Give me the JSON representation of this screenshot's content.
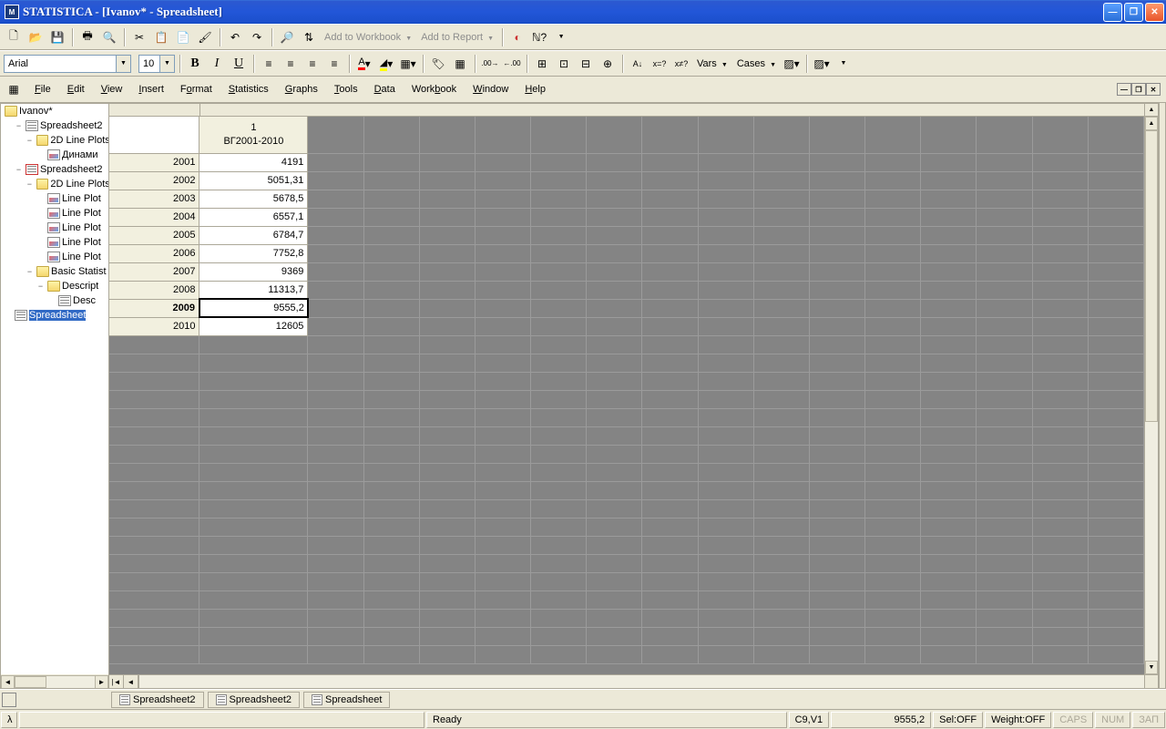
{
  "title": "STATISTICA - [Ivanov* - Spreadsheet]",
  "toolbar": {
    "addWorkbook": "Add to Workbook",
    "addReport": "Add to Report"
  },
  "format": {
    "font": "Arial",
    "size": "10",
    "vars": "Vars",
    "cases": "Cases"
  },
  "menus": [
    "File",
    "Edit",
    "View",
    "Insert",
    "Format",
    "Statistics",
    "Graphs",
    "Tools",
    "Data",
    "Workbook",
    "Window",
    "Help"
  ],
  "tree": {
    "root": "Ivanov*",
    "items": [
      {
        "ind": 1,
        "exp": "−",
        "icon": "sheet",
        "label": "Spreadsheet2"
      },
      {
        "ind": 2,
        "exp": "−",
        "icon": "folder",
        "label": "2D Line Plots"
      },
      {
        "ind": 3,
        "exp": "",
        "icon": "plot",
        "label": "Динами"
      },
      {
        "ind": 1,
        "exp": "−",
        "icon": "sheet red",
        "label": "Spreadsheet2"
      },
      {
        "ind": 2,
        "exp": "−",
        "icon": "folder",
        "label": "2D Line Plots"
      },
      {
        "ind": 3,
        "exp": "",
        "icon": "plot",
        "label": "Line Plot"
      },
      {
        "ind": 3,
        "exp": "",
        "icon": "plot",
        "label": "Line Plot"
      },
      {
        "ind": 3,
        "exp": "",
        "icon": "plot",
        "label": "Line Plot"
      },
      {
        "ind": 3,
        "exp": "",
        "icon": "plot",
        "label": "Line Plot"
      },
      {
        "ind": 3,
        "exp": "",
        "icon": "plot",
        "label": "Line Plot"
      },
      {
        "ind": 2,
        "exp": "−",
        "icon": "folder",
        "label": "Basic Statist"
      },
      {
        "ind": 3,
        "exp": "−",
        "icon": "folder",
        "label": "Descript"
      },
      {
        "ind": 4,
        "exp": "",
        "icon": "sheet",
        "label": "Desc"
      },
      {
        "ind": 0,
        "exp": "",
        "icon": "sheet",
        "label": "Spreadsheet",
        "sel": true
      }
    ]
  },
  "sheet": {
    "colNum": "1",
    "colName": "ВГ2001-2010",
    "rows": [
      {
        "h": "2001",
        "v": "4191"
      },
      {
        "h": "2002",
        "v": "5051,31"
      },
      {
        "h": "2003",
        "v": "5678,5"
      },
      {
        "h": "2004",
        "v": "6557,1"
      },
      {
        "h": "2005",
        "v": "6784,7"
      },
      {
        "h": "2006",
        "v": "7752,8"
      },
      {
        "h": "2007",
        "v": "9369"
      },
      {
        "h": "2008",
        "v": "11313,7"
      },
      {
        "h": "2009",
        "v": "9555,2",
        "sel": true
      },
      {
        "h": "2010",
        "v": "12605"
      }
    ],
    "emptyRows": 18,
    "emptyCols": 15
  },
  "docTabs": [
    "Spreadsheet2",
    "Spreadsheet2",
    "Spreadsheet"
  ],
  "status": {
    "ready": "Ready",
    "cell": "C9,V1",
    "value": "9555,2",
    "sel": "Sel:OFF",
    "weight": "Weight:OFF",
    "caps": "CAPS",
    "num": "NUM",
    "rec": "ЗАП"
  }
}
